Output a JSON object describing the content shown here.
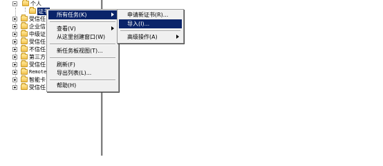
{
  "tree": {
    "items": [
      {
        "label": "个人"
      },
      {
        "label": "证书"
      },
      {
        "label": "受信任"
      },
      {
        "label": "企业信"
      },
      {
        "label": "中级证"
      },
      {
        "label": "受信任"
      },
      {
        "label": "不信任"
      },
      {
        "label": "第三方"
      },
      {
        "label": "受信任"
      },
      {
        "label": "Remote"
      },
      {
        "label": "智能卡"
      },
      {
        "label": "受信任"
      }
    ]
  },
  "context_menu": {
    "items": [
      {
        "label": "所有任务(K)"
      },
      {
        "label": "查看(V)"
      },
      {
        "label": "从这里创建窗口(W)"
      },
      {
        "label": "新任务板视图(T)..."
      },
      {
        "label": "刷新(F)"
      },
      {
        "label": "导出列表(L)..."
      },
      {
        "label": "帮助(H)"
      }
    ]
  },
  "submenu": {
    "items": [
      {
        "label": "申请新证书(R)..."
      },
      {
        "label": "导入(I)..."
      },
      {
        "label": "高级操作(A)"
      }
    ]
  },
  "colors": {
    "highlight": "#0a246a",
    "menu_bg": "#f0f0f0"
  }
}
